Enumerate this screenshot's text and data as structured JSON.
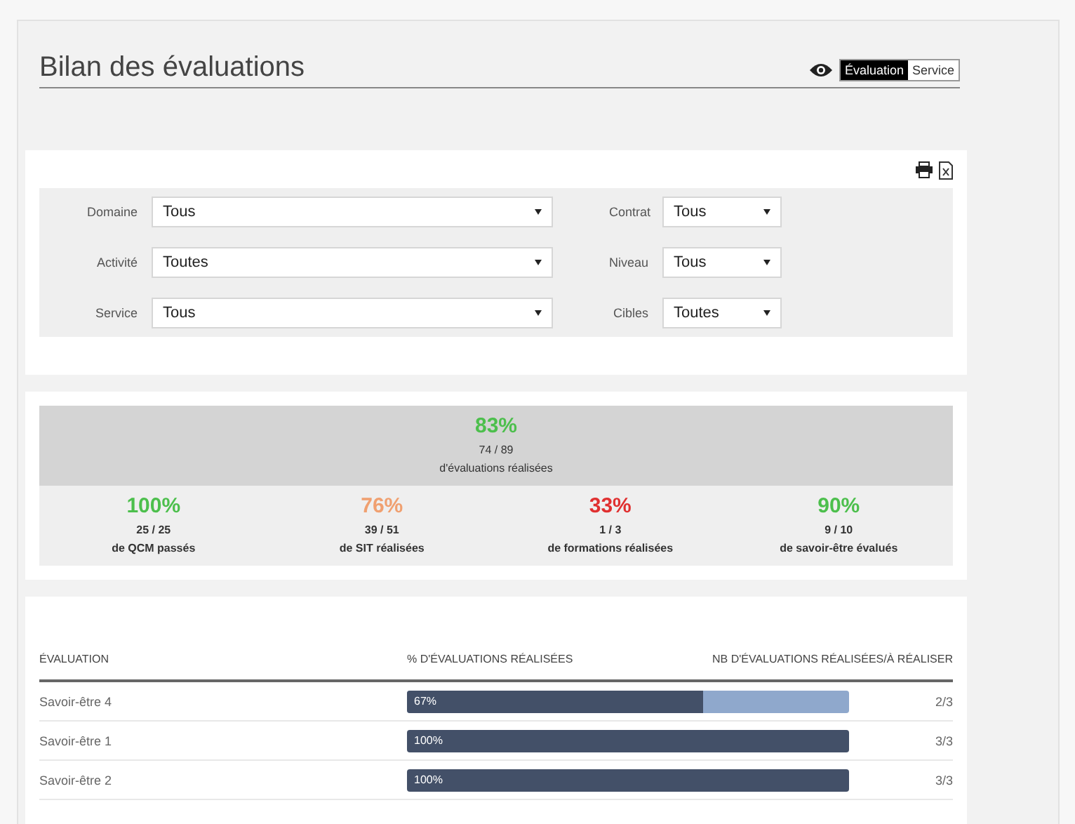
{
  "title": "Bilan des évaluations",
  "view_toggle": [
    {
      "label": "Évaluation",
      "selected": true
    },
    {
      "label": "Service",
      "selected": false
    }
  ],
  "filters_left": [
    {
      "label": "Domaine",
      "value": "Tous"
    },
    {
      "label": "Activité",
      "value": "Toutes"
    },
    {
      "label": "Service",
      "value": "Tous"
    }
  ],
  "filters_right": [
    {
      "label": "Contrat",
      "value": "Tous"
    },
    {
      "label": "Niveau",
      "value": "Tous"
    },
    {
      "label": "Cibles",
      "value": "Toutes"
    }
  ],
  "summary": {
    "percent": "83%",
    "count": "74 / 89",
    "caption": "d'évaluations réalisées",
    "color": "#4cbf4c"
  },
  "stats": [
    {
      "percent": "100%",
      "count": "25 / 25",
      "caption": "de QCM passés",
      "color": "#4cbf4c"
    },
    {
      "percent": "76%",
      "count": "39 / 51",
      "caption": "de SIT réalisées",
      "color": "#f0a070"
    },
    {
      "percent": "33%",
      "count": "1 / 3",
      "caption": "de formations réalisées",
      "color": "#e03030"
    },
    {
      "percent": "90%",
      "count": "9 / 10",
      "caption": "de savoir-être évalués",
      "color": "#4cbf4c"
    }
  ],
  "table": {
    "columns": [
      "ÉVALUATION",
      "% D'ÉVALUATIONS RÉALISÉES",
      "NB D'ÉVALUATIONS RÉALISÉES/À RÉALISER"
    ],
    "rows": [
      {
        "name": "Savoir-être 4",
        "level": 0.67,
        "percent": "67%",
        "ratio": "2/3"
      },
      {
        "name": "Savoir-être 1",
        "level": 1,
        "percent": "100%",
        "ratio": "3/3"
      },
      {
        "name": "Savoir-être 2",
        "level": 1,
        "percent": "100%",
        "ratio": "3/3"
      }
    ]
  }
}
